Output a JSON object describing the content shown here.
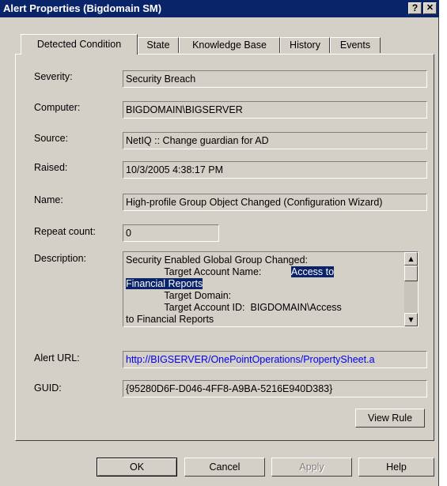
{
  "window": {
    "title": "Alert Properties (Bigdomain SM)",
    "help_glyph": "?",
    "close_glyph": "✕"
  },
  "tabs": [
    {
      "label": "Detected Condition",
      "active": true
    },
    {
      "label": "State",
      "active": false
    },
    {
      "label": "Knowledge Base",
      "active": false
    },
    {
      "label": "History",
      "active": false
    },
    {
      "label": "Events",
      "active": false
    }
  ],
  "fields": {
    "severity": {
      "label": "Severity:",
      "value": "Security Breach"
    },
    "computer": {
      "label": "Computer:",
      "value": "BIGDOMAIN\\BIGSERVER"
    },
    "source": {
      "label": "Source:",
      "value": "NetIQ :: Change guardian for AD"
    },
    "raised": {
      "label": "Raised:",
      "value": "10/3/2005 4:38:17 PM"
    },
    "name": {
      "label": "Name:",
      "value": "High-profile Group Object Changed (Configuration Wizard)"
    },
    "repeat_count": {
      "label": "Repeat count:",
      "value": "0"
    },
    "description": {
      "label": "Description:",
      "line1": "Security Enabled Global Group Changed:",
      "line2_prefix": "              Target Account Name:           ",
      "line2_selected": "Access to",
      "line3_selected": "Financial Reports",
      "line4": "              Target Domain:",
      "line5": "              Target Account ID:  BIGDOMAIN\\Access",
      "line6": "to Financial Reports"
    },
    "alert_url": {
      "label": "Alert URL:",
      "value": "http://BIGSERVER/OnePointOperations/PropertySheet.a"
    },
    "guid": {
      "label": "GUID:",
      "value": "{95280D6F-D046-4FF8-A9BA-5216E940D383}"
    }
  },
  "buttons": {
    "view_rule": "View Rule",
    "ok": "OK",
    "cancel": "Cancel",
    "apply": "Apply",
    "help": "Help"
  },
  "colors": {
    "title_bar": "#0a246a",
    "dialog_face": "#d4d0c8",
    "link": "#0000ee",
    "selection": "#0a246a"
  }
}
